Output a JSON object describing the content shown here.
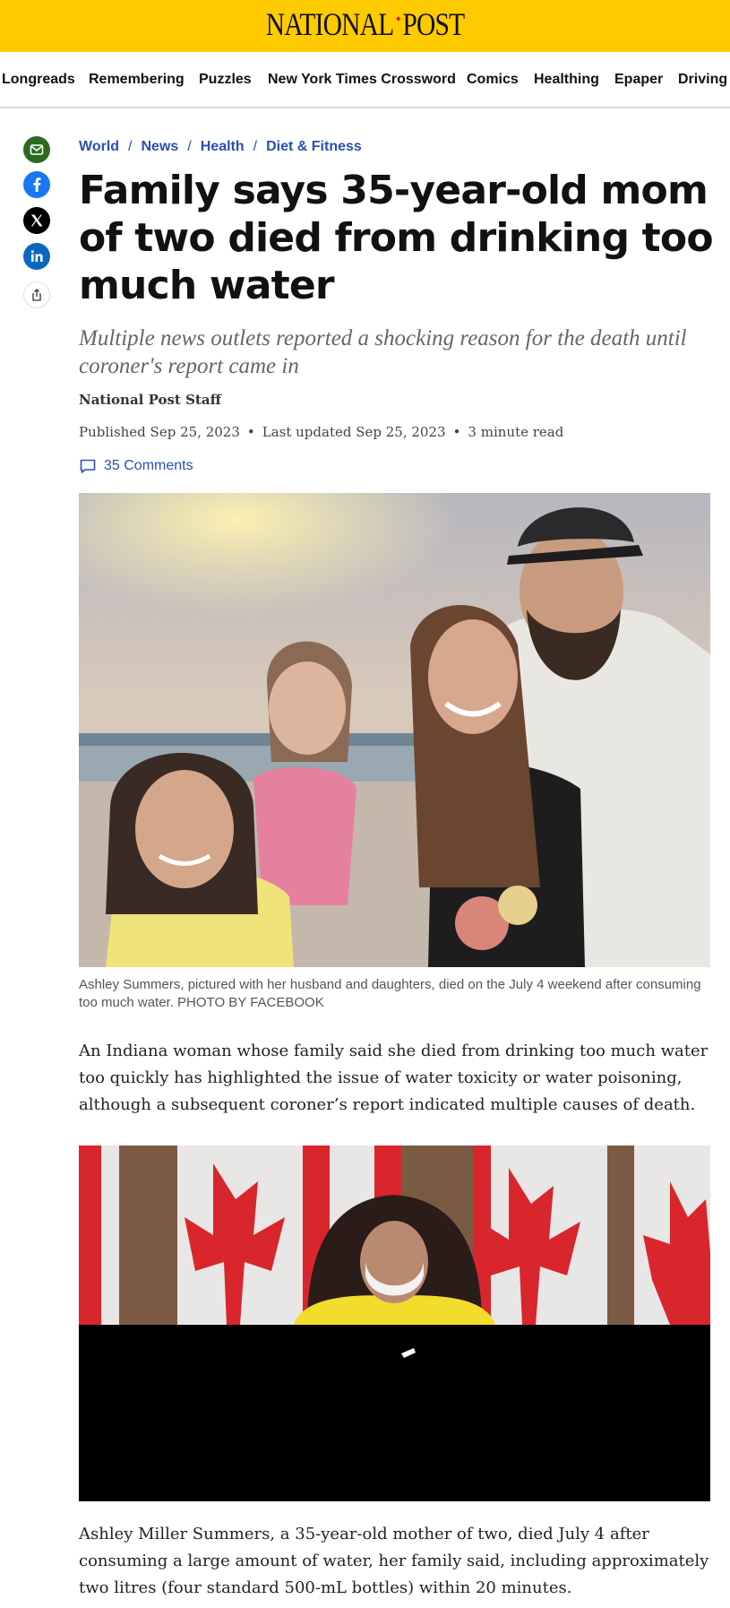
{
  "masthead": {
    "logo_left": "NATIONAL",
    "logo_right": "POST",
    "logo_leaf": "✦",
    "bg_color": "#fecb00"
  },
  "nav": {
    "items": [
      "Longreads",
      "Remembering",
      "Puzzles",
      "New York Times Crossword",
      "Comics",
      "Healthing",
      "Epaper",
      "Driving"
    ]
  },
  "share": {
    "icons": [
      "email-icon",
      "facebook-icon",
      "x-icon",
      "linkedin-icon",
      "share-icon"
    ],
    "colors": {
      "email": "#2d6a1f",
      "facebook": "#1877f2",
      "x": "#000000",
      "linkedin": "#0a66c2"
    }
  },
  "article": {
    "breadcrumb": [
      "World",
      "News",
      "Health",
      "Diet & Fitness"
    ],
    "breadcrumb_sep": "/",
    "headline": "Family says 35-year-old mom of two died from drinking too much water",
    "deck": "Multiple news outlets reported a shocking reason for the death until coroner's report came in",
    "author": "National Post Staff",
    "published": "Published Sep 25, 2023",
    "updated": "Last updated Sep 25, 2023",
    "read_time": "3 minute read",
    "meta_sep": "•",
    "comments": "35 Comments",
    "photo_caption": "Ashley Summers, pictured with her husband and daughters, died on the July 4 weekend after consuming too much water. PHOTO BY FACEBOOK",
    "para1": "An Indiana woman whose family said she died from drinking too much water too quickly has highlighted the issue of water toxicity or water poisoning, although a subsequent coroner’s report indicated multiple causes of death.",
    "para2": "Ashley Miller Summers, a 35-year-old mother of two, died July 4 after consuming a large amount of water, her family said, including approximately two litres (four standard 500-mL bottles) within 20 minutes."
  },
  "accent_color": "#2a4fb5"
}
